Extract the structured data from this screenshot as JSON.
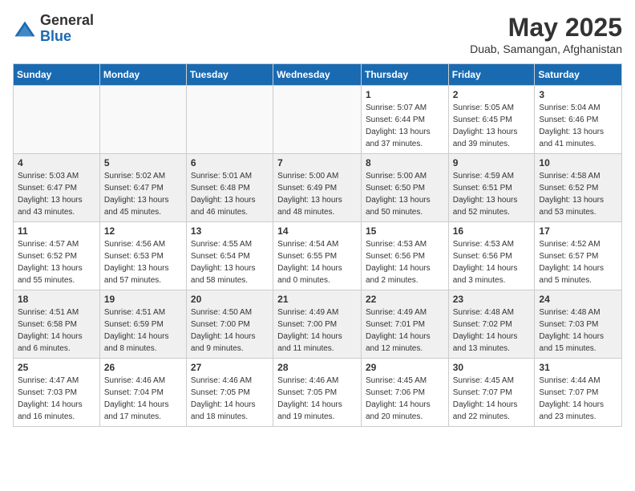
{
  "header": {
    "logo_general": "General",
    "logo_blue": "Blue",
    "title": "May 2025",
    "subtitle": "Duab, Samangan, Afghanistan"
  },
  "weekdays": [
    "Sunday",
    "Monday",
    "Tuesday",
    "Wednesday",
    "Thursday",
    "Friday",
    "Saturday"
  ],
  "weeks": [
    [
      {
        "day": "",
        "sunrise": "",
        "sunset": "",
        "daylight": ""
      },
      {
        "day": "",
        "sunrise": "",
        "sunset": "",
        "daylight": ""
      },
      {
        "day": "",
        "sunrise": "",
        "sunset": "",
        "daylight": ""
      },
      {
        "day": "",
        "sunrise": "",
        "sunset": "",
        "daylight": ""
      },
      {
        "day": "1",
        "sunrise": "Sunrise: 5:07 AM",
        "sunset": "Sunset: 6:44 PM",
        "daylight": "Daylight: 13 hours and 37 minutes."
      },
      {
        "day": "2",
        "sunrise": "Sunrise: 5:05 AM",
        "sunset": "Sunset: 6:45 PM",
        "daylight": "Daylight: 13 hours and 39 minutes."
      },
      {
        "day": "3",
        "sunrise": "Sunrise: 5:04 AM",
        "sunset": "Sunset: 6:46 PM",
        "daylight": "Daylight: 13 hours and 41 minutes."
      }
    ],
    [
      {
        "day": "4",
        "sunrise": "Sunrise: 5:03 AM",
        "sunset": "Sunset: 6:47 PM",
        "daylight": "Daylight: 13 hours and 43 minutes."
      },
      {
        "day": "5",
        "sunrise": "Sunrise: 5:02 AM",
        "sunset": "Sunset: 6:47 PM",
        "daylight": "Daylight: 13 hours and 45 minutes."
      },
      {
        "day": "6",
        "sunrise": "Sunrise: 5:01 AM",
        "sunset": "Sunset: 6:48 PM",
        "daylight": "Daylight: 13 hours and 46 minutes."
      },
      {
        "day": "7",
        "sunrise": "Sunrise: 5:00 AM",
        "sunset": "Sunset: 6:49 PM",
        "daylight": "Daylight: 13 hours and 48 minutes."
      },
      {
        "day": "8",
        "sunrise": "Sunrise: 5:00 AM",
        "sunset": "Sunset: 6:50 PM",
        "daylight": "Daylight: 13 hours and 50 minutes."
      },
      {
        "day": "9",
        "sunrise": "Sunrise: 4:59 AM",
        "sunset": "Sunset: 6:51 PM",
        "daylight": "Daylight: 13 hours and 52 minutes."
      },
      {
        "day": "10",
        "sunrise": "Sunrise: 4:58 AM",
        "sunset": "Sunset: 6:52 PM",
        "daylight": "Daylight: 13 hours and 53 minutes."
      }
    ],
    [
      {
        "day": "11",
        "sunrise": "Sunrise: 4:57 AM",
        "sunset": "Sunset: 6:52 PM",
        "daylight": "Daylight: 13 hours and 55 minutes."
      },
      {
        "day": "12",
        "sunrise": "Sunrise: 4:56 AM",
        "sunset": "Sunset: 6:53 PM",
        "daylight": "Daylight: 13 hours and 57 minutes."
      },
      {
        "day": "13",
        "sunrise": "Sunrise: 4:55 AM",
        "sunset": "Sunset: 6:54 PM",
        "daylight": "Daylight: 13 hours and 58 minutes."
      },
      {
        "day": "14",
        "sunrise": "Sunrise: 4:54 AM",
        "sunset": "Sunset: 6:55 PM",
        "daylight": "Daylight: 14 hours and 0 minutes."
      },
      {
        "day": "15",
        "sunrise": "Sunrise: 4:53 AM",
        "sunset": "Sunset: 6:56 PM",
        "daylight": "Daylight: 14 hours and 2 minutes."
      },
      {
        "day": "16",
        "sunrise": "Sunrise: 4:53 AM",
        "sunset": "Sunset: 6:56 PM",
        "daylight": "Daylight: 14 hours and 3 minutes."
      },
      {
        "day": "17",
        "sunrise": "Sunrise: 4:52 AM",
        "sunset": "Sunset: 6:57 PM",
        "daylight": "Daylight: 14 hours and 5 minutes."
      }
    ],
    [
      {
        "day": "18",
        "sunrise": "Sunrise: 4:51 AM",
        "sunset": "Sunset: 6:58 PM",
        "daylight": "Daylight: 14 hours and 6 minutes."
      },
      {
        "day": "19",
        "sunrise": "Sunrise: 4:51 AM",
        "sunset": "Sunset: 6:59 PM",
        "daylight": "Daylight: 14 hours and 8 minutes."
      },
      {
        "day": "20",
        "sunrise": "Sunrise: 4:50 AM",
        "sunset": "Sunset: 7:00 PM",
        "daylight": "Daylight: 14 hours and 9 minutes."
      },
      {
        "day": "21",
        "sunrise": "Sunrise: 4:49 AM",
        "sunset": "Sunset: 7:00 PM",
        "daylight": "Daylight: 14 hours and 11 minutes."
      },
      {
        "day": "22",
        "sunrise": "Sunrise: 4:49 AM",
        "sunset": "Sunset: 7:01 PM",
        "daylight": "Daylight: 14 hours and 12 minutes."
      },
      {
        "day": "23",
        "sunrise": "Sunrise: 4:48 AM",
        "sunset": "Sunset: 7:02 PM",
        "daylight": "Daylight: 14 hours and 13 minutes."
      },
      {
        "day": "24",
        "sunrise": "Sunrise: 4:48 AM",
        "sunset": "Sunset: 7:03 PM",
        "daylight": "Daylight: 14 hours and 15 minutes."
      }
    ],
    [
      {
        "day": "25",
        "sunrise": "Sunrise: 4:47 AM",
        "sunset": "Sunset: 7:03 PM",
        "daylight": "Daylight: 14 hours and 16 minutes."
      },
      {
        "day": "26",
        "sunrise": "Sunrise: 4:46 AM",
        "sunset": "Sunset: 7:04 PM",
        "daylight": "Daylight: 14 hours and 17 minutes."
      },
      {
        "day": "27",
        "sunrise": "Sunrise: 4:46 AM",
        "sunset": "Sunset: 7:05 PM",
        "daylight": "Daylight: 14 hours and 18 minutes."
      },
      {
        "day": "28",
        "sunrise": "Sunrise: 4:46 AM",
        "sunset": "Sunset: 7:05 PM",
        "daylight": "Daylight: 14 hours and 19 minutes."
      },
      {
        "day": "29",
        "sunrise": "Sunrise: 4:45 AM",
        "sunset": "Sunset: 7:06 PM",
        "daylight": "Daylight: 14 hours and 20 minutes."
      },
      {
        "day": "30",
        "sunrise": "Sunrise: 4:45 AM",
        "sunset": "Sunset: 7:07 PM",
        "daylight": "Daylight: 14 hours and 22 minutes."
      },
      {
        "day": "31",
        "sunrise": "Sunrise: 4:44 AM",
        "sunset": "Sunset: 7:07 PM",
        "daylight": "Daylight: 14 hours and 23 minutes."
      }
    ]
  ]
}
